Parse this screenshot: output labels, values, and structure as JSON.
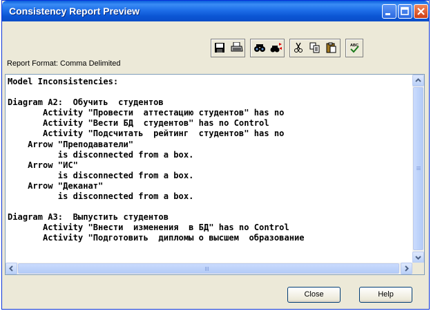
{
  "window": {
    "title": "Consistency Report Preview"
  },
  "toolbar": {
    "groups": [
      [
        "save-icon",
        "print-icon"
      ],
      [
        "find-icon",
        "replace-icon"
      ],
      [
        "cut-icon",
        "copy-icon",
        "paste-icon"
      ],
      [
        "spellcheck-icon"
      ]
    ]
  },
  "report": {
    "format_label": "Report Format: Comma Delimited",
    "lines": [
      "Model Inconsistencies:",
      "",
      "Diagram A2:  Обучить  студентов",
      "       Activity \"Провести  аттестацию студентов\" has no",
      "       Activity \"Вести БД  студентов\" has no Control",
      "       Activity \"Подсчитать  рейтинг  студентов\" has no",
      "    Arrow \"Преподаватели\"",
      "          is disconnected from a box.",
      "    Arrow \"ИС\"",
      "          is disconnected from a box.",
      "    Arrow \"Деканат\"",
      "          is disconnected from a box.",
      "",
      "Diagram A3:  Выпустить студентов",
      "       Activity \"Внести  изменения  в БД\" has no Control",
      "       Activity \"Подготовить  дипломы о высшем  образование"
    ]
  },
  "buttons": {
    "close": "Close",
    "help": "Help"
  },
  "colors": {
    "titlebar": "#0a5ddc",
    "window_bg": "#ece9d8",
    "close_button": "#e0552a"
  }
}
